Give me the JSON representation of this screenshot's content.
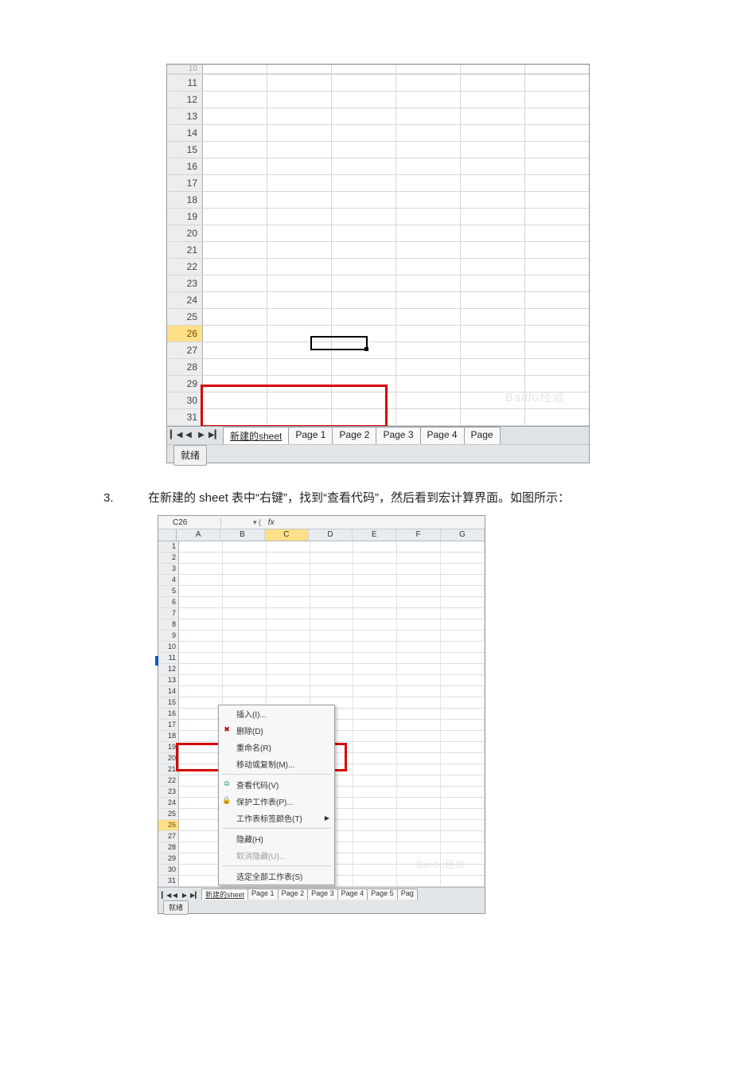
{
  "fig1": {
    "first_partial_row": "10",
    "rows": [
      "11",
      "12",
      "13",
      "14",
      "15",
      "16",
      "17",
      "18",
      "19",
      "20",
      "21",
      "22",
      "23",
      "24",
      "25",
      "26",
      "27",
      "28",
      "29",
      "30",
      "31"
    ],
    "highlight_row": "26",
    "nav": {
      "first": "▎◀",
      "prev": "◀",
      "next": "▶",
      "last": "▶▎"
    },
    "tabs": [
      "新建的sheet",
      "Page 1",
      "Page 2",
      "Page 3",
      "Page 4",
      "Page"
    ],
    "active_tab_index": 0,
    "status": "就绪",
    "watermark": "Baidu经验"
  },
  "step3": {
    "number": "3.",
    "text_1": "在新建的 sheet 表中“右键”，找到“查看代码”，然后看到宏计算界面。如图所示："
  },
  "fig2": {
    "namebox": "C26",
    "fx_label": "fx",
    "columns": [
      "A",
      "B",
      "C",
      "D",
      "E",
      "F",
      "G"
    ],
    "selected_col": "C",
    "rows": [
      "1",
      "2",
      "3",
      "4",
      "5",
      "6",
      "7",
      "8",
      "9",
      "10",
      "11",
      "12",
      "13",
      "14",
      "15",
      "16",
      "17",
      "18",
      "19",
      "20",
      "21",
      "22",
      "23",
      "24",
      "25",
      "26",
      "27",
      "28",
      "29",
      "30",
      "31"
    ],
    "highlight_row": "26",
    "marker_row": "12",
    "context_menu": [
      {
        "label": "插入(I)...",
        "icon": "",
        "disabled": false,
        "submenu": false
      },
      {
        "label": "删除(D)",
        "icon": "del",
        "disabled": false,
        "submenu": false
      },
      {
        "label": "重命名(R)",
        "icon": "",
        "disabled": false,
        "submenu": false
      },
      {
        "label": "移动或复制(M)...",
        "icon": "",
        "disabled": false,
        "submenu": false
      },
      {
        "sep": true
      },
      {
        "label": "查看代码(V)",
        "icon": "code",
        "disabled": false,
        "submenu": false
      },
      {
        "label": "保护工作表(P)...",
        "icon": "lock",
        "disabled": false,
        "submenu": false
      },
      {
        "label": "工作表标签颜色(T)",
        "icon": "",
        "disabled": false,
        "submenu": true
      },
      {
        "sep": true
      },
      {
        "label": "隐藏(H)",
        "icon": "",
        "disabled": false,
        "submenu": false
      },
      {
        "label": "取消隐藏(U)...",
        "icon": "",
        "disabled": true,
        "submenu": false
      },
      {
        "sep": true
      },
      {
        "label": "选定全部工作表(S)",
        "icon": "",
        "disabled": false,
        "submenu": false
      }
    ],
    "nav": {
      "first": "▎◀",
      "prev": "◀",
      "next": "▶",
      "last": "▶▎"
    },
    "tabs": [
      "新建的sheet",
      "Page 1",
      "Page 2",
      "Page 3",
      "Page 4",
      "Page 5",
      "Pag"
    ],
    "active_tab_index": 0,
    "status": "就绪",
    "watermark": "Baidu经验"
  }
}
